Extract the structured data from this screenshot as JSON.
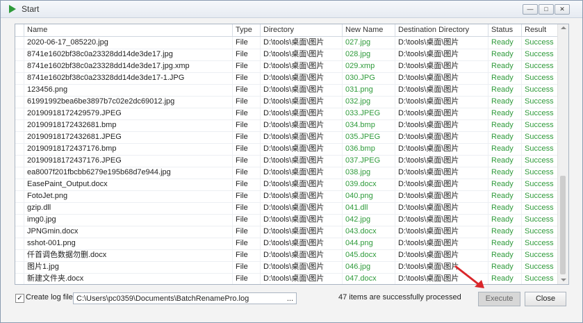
{
  "window": {
    "title": "Start"
  },
  "window_buttons": {
    "minimize": "—",
    "maximize": "□",
    "close": "✕"
  },
  "columns": [
    "Name",
    "Type",
    "Directory",
    "New Name",
    "Destination Directory",
    "Status",
    "Result"
  ],
  "rows": [
    {
      "name": "2020-06-17_085220.jpg",
      "type": "File",
      "directory": "D:\\tools\\桌面\\图片",
      "new_name": "027.jpg",
      "dest": "D:\\tools\\桌面\\图片",
      "status": "Ready",
      "result": "Success"
    },
    {
      "name": "8741e1602bf38c0a23328dd14de3de17.jpg",
      "type": "File",
      "directory": "D:\\tools\\桌面\\图片",
      "new_name": "028.jpg",
      "dest": "D:\\tools\\桌面\\图片",
      "status": "Ready",
      "result": "Success"
    },
    {
      "name": "8741e1602bf38c0a23328dd14de3de17.jpg.xmp",
      "type": "File",
      "directory": "D:\\tools\\桌面\\图片",
      "new_name": "029.xmp",
      "dest": "D:\\tools\\桌面\\图片",
      "status": "Ready",
      "result": "Success"
    },
    {
      "name": "8741e1602bf38c0a23328dd14de3de17-1.JPG",
      "type": "File",
      "directory": "D:\\tools\\桌面\\图片",
      "new_name": "030.JPG",
      "dest": "D:\\tools\\桌面\\图片",
      "status": "Ready",
      "result": "Success"
    },
    {
      "name": "123456.png",
      "type": "File",
      "directory": "D:\\tools\\桌面\\图片",
      "new_name": "031.png",
      "dest": "D:\\tools\\桌面\\图片",
      "status": "Ready",
      "result": "Success"
    },
    {
      "name": "61991992bea6be3897b7c02e2dc69012.jpg",
      "type": "File",
      "directory": "D:\\tools\\桌面\\图片",
      "new_name": "032.jpg",
      "dest": "D:\\tools\\桌面\\图片",
      "status": "Ready",
      "result": "Success"
    },
    {
      "name": "20190918172429579.JPEG",
      "type": "File",
      "directory": "D:\\tools\\桌面\\图片",
      "new_name": "033.JPEG",
      "dest": "D:\\tools\\桌面\\图片",
      "status": "Ready",
      "result": "Success"
    },
    {
      "name": "20190918172432681.bmp",
      "type": "File",
      "directory": "D:\\tools\\桌面\\图片",
      "new_name": "034.bmp",
      "dest": "D:\\tools\\桌面\\图片",
      "status": "Ready",
      "result": "Success"
    },
    {
      "name": "20190918172432681.JPEG",
      "type": "File",
      "directory": "D:\\tools\\桌面\\图片",
      "new_name": "035.JPEG",
      "dest": "D:\\tools\\桌面\\图片",
      "status": "Ready",
      "result": "Success"
    },
    {
      "name": "20190918172437176.bmp",
      "type": "File",
      "directory": "D:\\tools\\桌面\\图片",
      "new_name": "036.bmp",
      "dest": "D:\\tools\\桌面\\图片",
      "status": "Ready",
      "result": "Success"
    },
    {
      "name": "20190918172437176.JPEG",
      "type": "File",
      "directory": "D:\\tools\\桌面\\图片",
      "new_name": "037.JPEG",
      "dest": "D:\\tools\\桌面\\图片",
      "status": "Ready",
      "result": "Success"
    },
    {
      "name": "ea8007f201fbcbb6279e195b68d7e944.jpg",
      "type": "File",
      "directory": "D:\\tools\\桌面\\图片",
      "new_name": "038.jpg",
      "dest": "D:\\tools\\桌面\\图片",
      "status": "Ready",
      "result": "Success"
    },
    {
      "name": "EasePaint_Output.docx",
      "type": "File",
      "directory": "D:\\tools\\桌面\\图片",
      "new_name": "039.docx",
      "dest": "D:\\tools\\桌面\\图片",
      "status": "Ready",
      "result": "Success"
    },
    {
      "name": "FotoJet.png",
      "type": "File",
      "directory": "D:\\tools\\桌面\\图片",
      "new_name": "040.png",
      "dest": "D:\\tools\\桌面\\图片",
      "status": "Ready",
      "result": "Success"
    },
    {
      "name": "gzip.dll",
      "type": "File",
      "directory": "D:\\tools\\桌面\\图片",
      "new_name": "041.dll",
      "dest": "D:\\tools\\桌面\\图片",
      "status": "Ready",
      "result": "Success"
    },
    {
      "name": "img0.jpg",
      "type": "File",
      "directory": "D:\\tools\\桌面\\图片",
      "new_name": "042.jpg",
      "dest": "D:\\tools\\桌面\\图片",
      "status": "Ready",
      "result": "Success"
    },
    {
      "name": "JPNGmin.docx",
      "type": "File",
      "directory": "D:\\tools\\桌面\\图片",
      "new_name": "043.docx",
      "dest": "D:\\tools\\桌面\\图片",
      "status": "Ready",
      "result": "Success"
    },
    {
      "name": "sshot-001.png",
      "type": "File",
      "directory": "D:\\tools\\桌面\\图片",
      "new_name": "044.png",
      "dest": "D:\\tools\\桌面\\图片",
      "status": "Ready",
      "result": "Success"
    },
    {
      "name": "仟首调色数据勿删.docx",
      "type": "File",
      "directory": "D:\\tools\\桌面\\图片",
      "new_name": "045.docx",
      "dest": "D:\\tools\\桌面\\图片",
      "status": "Ready",
      "result": "Success"
    },
    {
      "name": "图片1.jpg",
      "type": "File",
      "directory": "D:\\tools\\桌面\\图片",
      "new_name": "046.jpg",
      "dest": "D:\\tools\\桌面\\图片",
      "status": "Ready",
      "result": "Success"
    },
    {
      "name": "新建文件夹.docx",
      "type": "File",
      "directory": "D:\\tools\\桌面\\图片",
      "new_name": "047.docx",
      "dest": "D:\\tools\\桌面\\图片",
      "status": "Ready",
      "result": "Success"
    }
  ],
  "bottom": {
    "checkbox_label": "Create log file:",
    "checkbox_mark": "✓",
    "log_path": "C:\\Users\\pc0359\\Documents\\BatchRenamePro.log",
    "browse": "...",
    "status_text": "47 items are successfully processed",
    "execute_label": "Execute",
    "close_label": "Close"
  },
  "colors": {
    "accent_green": "#2e9a3a",
    "arrow_red": "#d9262a"
  }
}
